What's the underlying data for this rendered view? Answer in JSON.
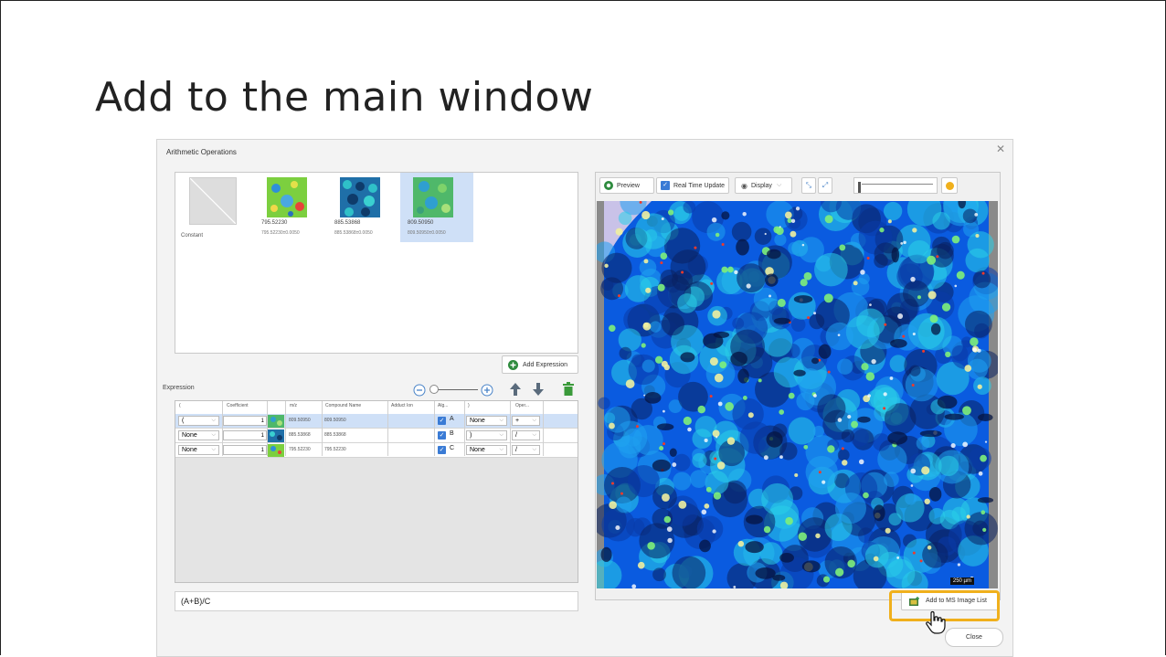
{
  "slide": {
    "title": "Add to the main window"
  },
  "dialog": {
    "title": "Arithmetic Operations",
    "close_glyph": "✕"
  },
  "thumbnails": [
    {
      "kind": "constant",
      "label": "Constant"
    },
    {
      "kind": "image",
      "mz": "795.52230",
      "range": "795.52230±0.0050",
      "selected": false
    },
    {
      "kind": "image",
      "mz": "885.53868",
      "range": "885.53868±0.0050",
      "selected": false
    },
    {
      "kind": "image",
      "mz": "809.50950",
      "range": "809.50950±0.0050",
      "selected": true
    }
  ],
  "add_expression": {
    "label": "Add Expression",
    "icon": "plus-circle-icon"
  },
  "expression": {
    "label": "Expression",
    "headers": [
      "(",
      "Coefficient",
      "",
      "m/z",
      "Compound Name",
      "Adduct Ion",
      "Alg...",
      ")",
      "Oper..."
    ],
    "rows": [
      {
        "open": "(",
        "coef": "1",
        "mz": "809.50950",
        "name": "809.50950",
        "adduct": "",
        "alg": "A",
        "close": "None",
        "op": "+",
        "selected": true
      },
      {
        "open": "None",
        "coef": "1",
        "mz": "885.53868",
        "name": "885.53868",
        "adduct": "",
        "alg": "B",
        "close": ")",
        "op": "/",
        "selected": false
      },
      {
        "open": "None",
        "coef": "1",
        "mz": "795.52230",
        "name": "795.52230",
        "adduct": "",
        "alg": "C",
        "close": "None",
        "op": "/",
        "selected": false
      }
    ],
    "formula": "(A+B)/C"
  },
  "toolbar": {
    "preview": "Preview",
    "realtime": "Real Time Update",
    "display": "Display"
  },
  "image": {
    "scale_label": "250 µm"
  },
  "add_ms": {
    "label": "Add to MS Image List"
  },
  "close_button": {
    "label": "Close"
  },
  "colors": {
    "highlight": "#f0b01c",
    "selection": "#cfe0f7",
    "accent": "#3a7bd5"
  }
}
